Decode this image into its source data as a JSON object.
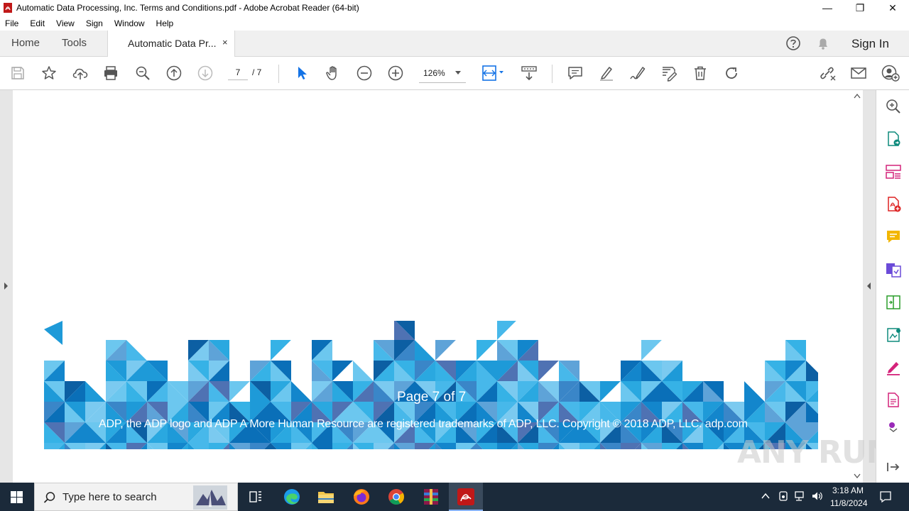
{
  "window": {
    "title": "Automatic Data Processing, Inc. Terms and Conditions.pdf - Adobe Acrobat Reader (64-bit)",
    "controls": [
      "minimize-icon",
      "restore-icon",
      "close-icon"
    ]
  },
  "menu": [
    "File",
    "Edit",
    "View",
    "Sign",
    "Window",
    "Help"
  ],
  "tabs": {
    "home": "Home",
    "tools": "Tools",
    "document": "Automatic Data Pr...",
    "close": "×",
    "sign_in": "Sign In"
  },
  "toolbar": {
    "page_current": "7",
    "page_total": "/ 7",
    "zoom": "126%"
  },
  "document": {
    "page_label": "Page 7 of 7",
    "trademark": "ADP, the ADP logo and ADP A More Human Resource are registered trademarks of ADP, LLC.  Copyright © 2018 ADP, LLC.     adp.com",
    "watermark": "ANY RUN"
  },
  "taskbar": {
    "search_placeholder": "Type here to search",
    "time": "3:18 AM",
    "date": "11/8/2024"
  },
  "colors": {
    "acrobat_red": "#c01818",
    "accent_blue": "#1473e6",
    "banner_blue": "#1a8fd6",
    "taskbar": "#1b2a3a"
  }
}
